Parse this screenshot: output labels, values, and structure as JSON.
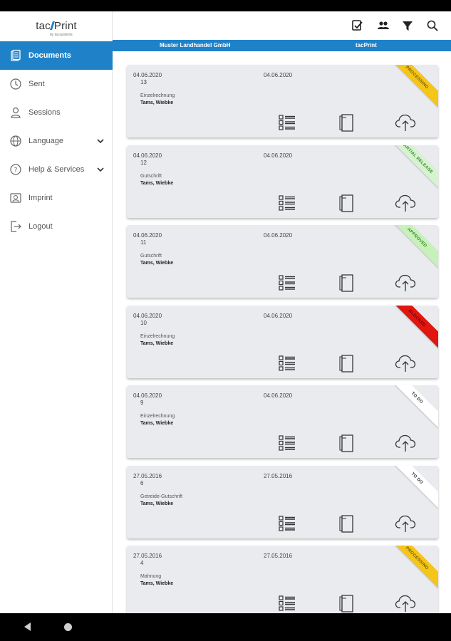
{
  "app": {
    "logo_text": "tacPrint",
    "logo_sub": "by tacsystems"
  },
  "sidebar": {
    "items": [
      {
        "label": "Documents",
        "icon": "documents-icon"
      },
      {
        "label": "Sent",
        "icon": "clock-icon"
      },
      {
        "label": "Sessions",
        "icon": "person-icon"
      },
      {
        "label": "Language",
        "icon": "globe-icon"
      },
      {
        "label": "Help & Services",
        "icon": "help-icon"
      },
      {
        "label": "Imprint",
        "icon": "imprint-icon"
      },
      {
        "label": "Logout",
        "icon": "logout-icon"
      }
    ]
  },
  "header": {
    "icons": [
      "checklist-icon",
      "users-icon",
      "filter-icon",
      "search-icon"
    ],
    "company": "Muster Landhandel GmbH",
    "product": "tacPrint"
  },
  "colors": {
    "accent": "#1f82c9",
    "processing": "#f5c518",
    "partial_release": "#c9eec4",
    "approved": "#c6f1b8",
    "blocked": "#e0160f",
    "todo": "#ffffff"
  },
  "documents": [
    {
      "date1": "04.06.2020",
      "date2": "04.06.2020",
      "number": "13",
      "type": "Einzelrechnung",
      "name": "Tams, Wiebke",
      "status": "PROCESSING",
      "status_color": "#f5c518",
      "status_text_color": "#7a5a00"
    },
    {
      "date1": "04.06.2020",
      "date2": "04.06.2020",
      "number": "12",
      "type": "Gutschrift",
      "name": "Tams, Wiebke",
      "status": "PARTIAL RELEASE",
      "status_color": "#d6f3d0",
      "status_text_color": "#3d8a2a"
    },
    {
      "date1": "04.06.2020",
      "date2": "04.06.2020",
      "number": "11",
      "type": "Gutschrift",
      "name": "Tams, Wiebke",
      "status": "APPROVED",
      "status_color": "#c6f1b8",
      "status_text_color": "#3d8a2a"
    },
    {
      "date1": "04.06.2020",
      "date2": "04.06.2020",
      "number": "10",
      "type": "Einzelrechnung",
      "name": "Tams, Wiebke",
      "status": "BLOCKED",
      "status_color": "#e0160f",
      "status_text_color": "#7a0000"
    },
    {
      "date1": "04.06.2020",
      "date2": "04.06.2020",
      "number": "9",
      "type": "Einzelrechnung",
      "name": "Tams, Wiebke",
      "status": "TO DO",
      "status_color": "#ffffff",
      "status_text_color": "#333333"
    },
    {
      "date1": "27.05.2016",
      "date2": "27.05.2016",
      "number": "6",
      "type": "Getreide-Gutschrift",
      "name": "Tams, Wiebke",
      "status": "TO DO",
      "status_color": "#ffffff",
      "status_text_color": "#333333"
    },
    {
      "date1": "27.05.2016",
      "date2": "27.05.2016",
      "number": "4",
      "type": "Mahnung",
      "name": "Tams, Wiebke",
      "status": "PROCESSING",
      "status_color": "#f5c518",
      "status_text_color": "#7a5a00"
    }
  ]
}
